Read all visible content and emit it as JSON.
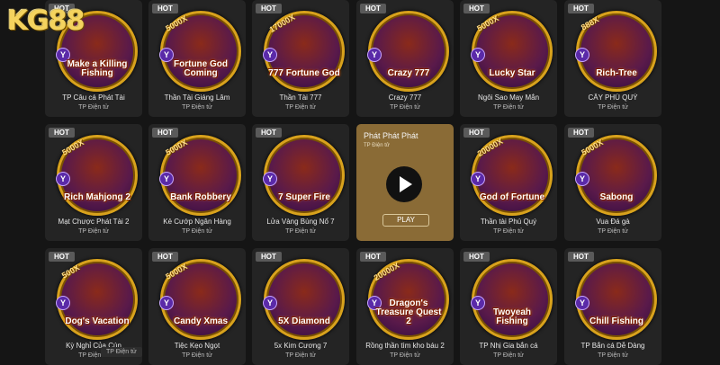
{
  "brand": {
    "logo_text": "KG88"
  },
  "hot_label": "HOT",
  "y_badge": "Y",
  "provider": "TP Điện tử",
  "games": [
    {
      "title": "TP Câu cá Phát Tài",
      "icon": "Make a Killing Fishing",
      "mult": ""
    },
    {
      "title": "Thần Tài Giáng Lâm",
      "icon": "Fortune God Coming",
      "mult": "5000X"
    },
    {
      "title": "Thần Tài 777",
      "icon": "777 Fortune God",
      "mult": "17000X"
    },
    {
      "title": "Crazy 777",
      "icon": "Crazy 777",
      "mult": ""
    },
    {
      "title": "Ngôi Sao May Mắn",
      "icon": "Lucky Star",
      "mult": "5000X"
    },
    {
      "title": "CÂY PHÚ QUÝ",
      "icon": "Rich-Tree",
      "mult": "888X"
    },
    {
      "title": "Mạt Chược Phát Tài 2",
      "icon": "Rich Mahjong 2",
      "mult": "5000X"
    },
    {
      "title": "Kẻ Cướp Ngân Hàng",
      "icon": "Bank Robbery",
      "mult": "5000X"
    },
    {
      "title": "Lửa Vàng Bùng Nổ 7",
      "icon": "7 Super Fire",
      "mult": ""
    },
    {
      "title": "Phát Phát Phát",
      "icon": "",
      "mult": ""
    },
    {
      "title": "Thần tài Phú Quý",
      "icon": "God of Fortune",
      "mult": "20000X"
    },
    {
      "title": "Vua Đá gà",
      "icon": "Sabong",
      "mult": "5000X"
    },
    {
      "title": "Kỳ Nghỉ Của Cún",
      "icon": "Dog's Vacation",
      "mult": "500X"
    },
    {
      "title": "Tiệc Kẹo Ngọt",
      "icon": "Candy Xmas",
      "mult": "5000X"
    },
    {
      "title": "5x Kim Cương 7",
      "icon": "5X Diamond",
      "mult": ""
    },
    {
      "title": "Rồng thần tìm kho báu 2",
      "icon": "Dragon's Treasure Quest 2",
      "mult": "20000X"
    },
    {
      "title": "TP Nhị Gia bắn cá",
      "icon": "Twoyeah Fishing",
      "mult": ""
    },
    {
      "title": "TP Bắn cá Dễ Dàng",
      "icon": "Chill Fishing",
      "mult": ""
    }
  ],
  "active_card": {
    "title": "Phát Phát Phát",
    "provider": "TP Điện tử",
    "play_label": "PLAY"
  },
  "footer_tag": "TP Điện tử"
}
